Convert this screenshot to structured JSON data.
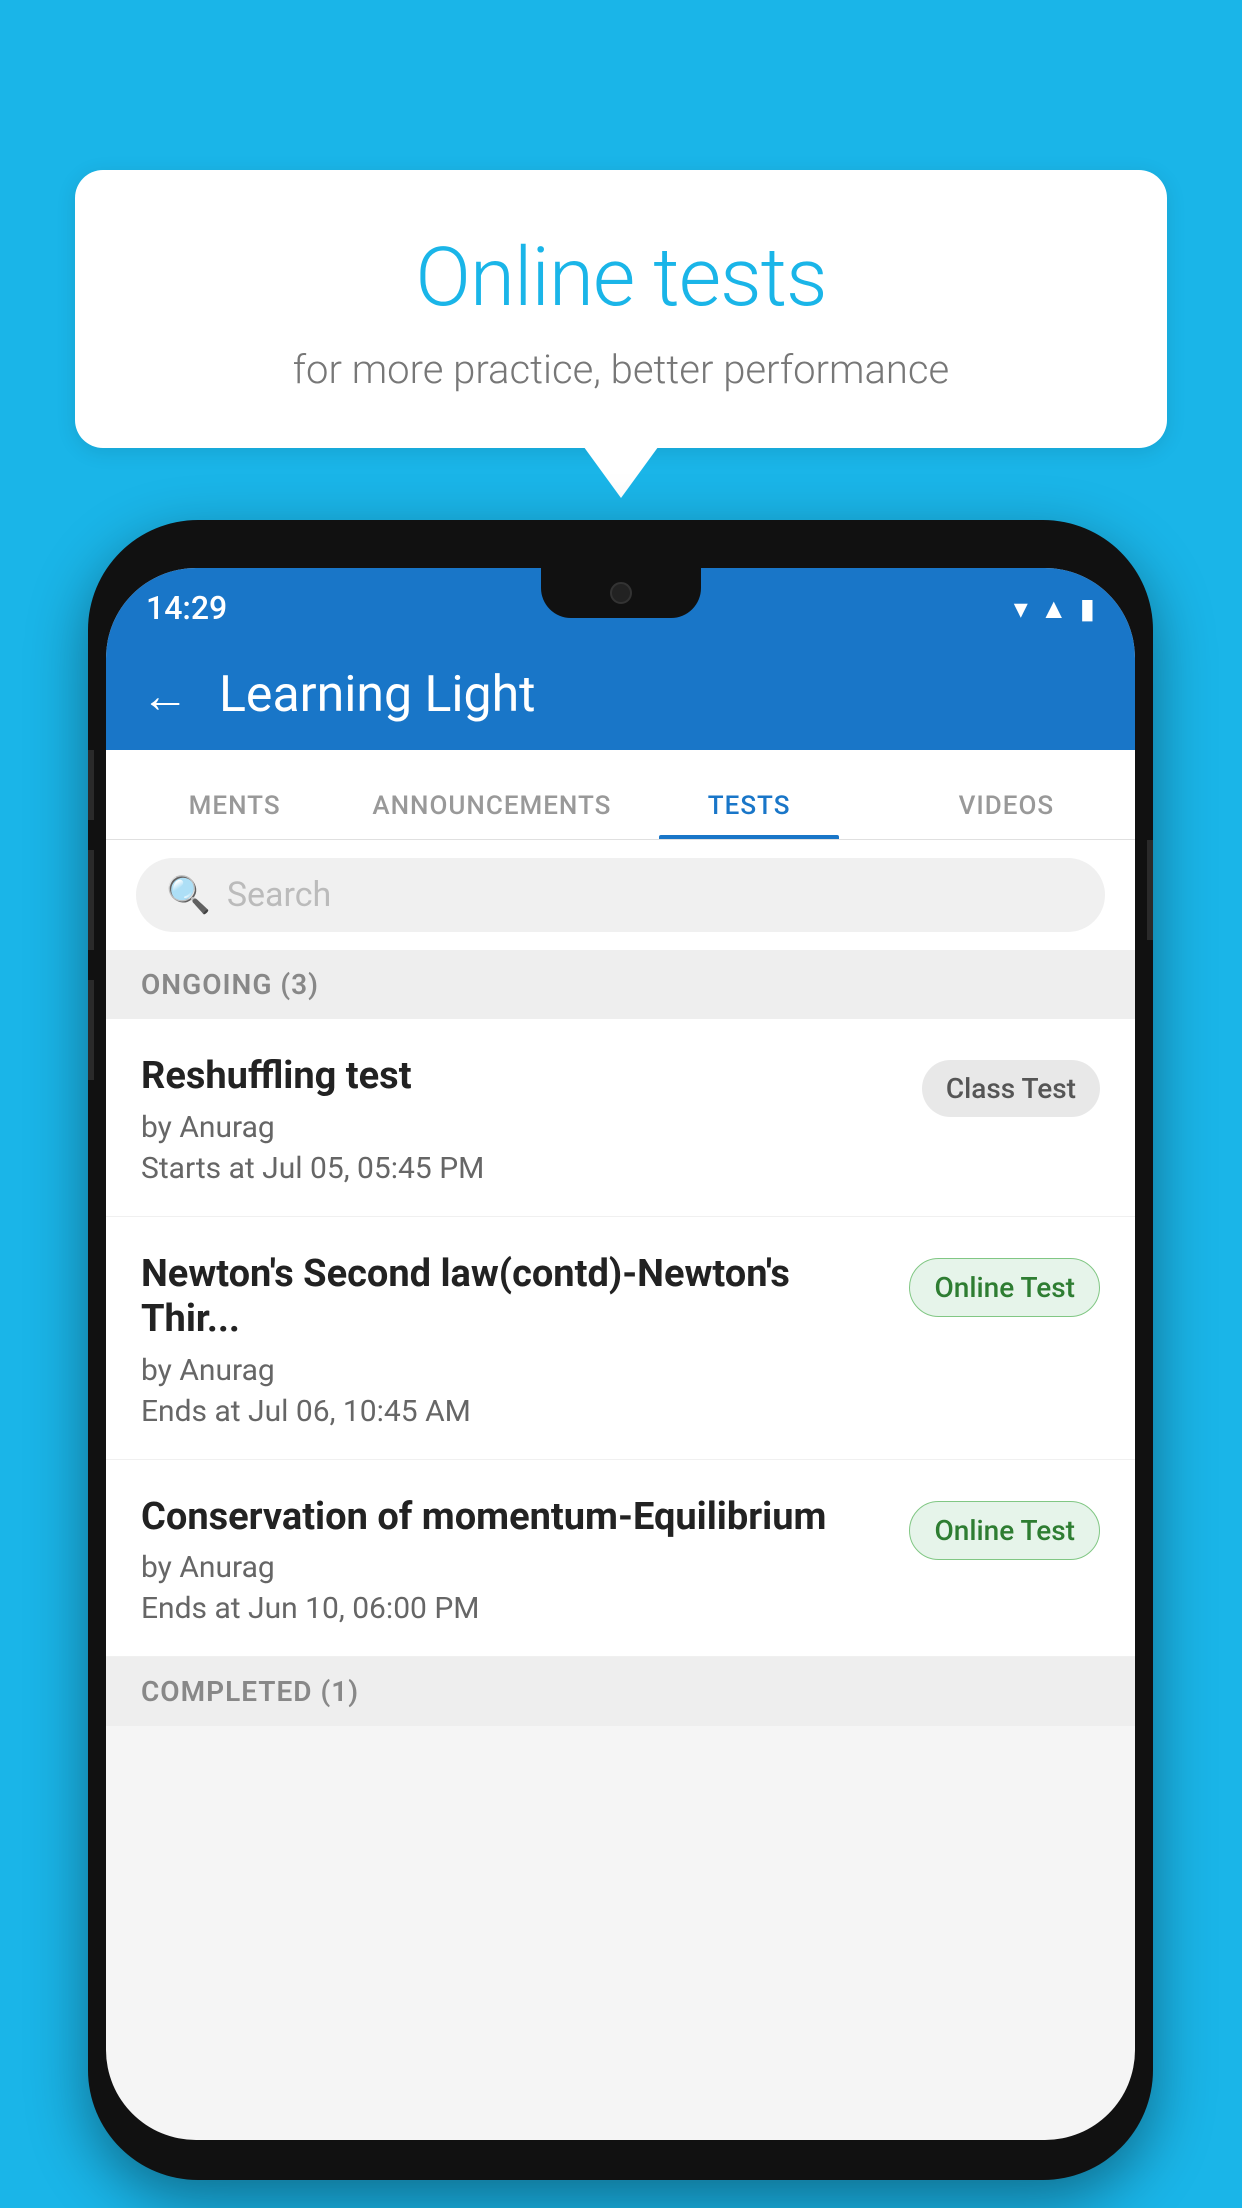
{
  "background_color": "#1ab5e8",
  "speech_bubble": {
    "title": "Online tests",
    "subtitle": "for more practice, better performance"
  },
  "phone": {
    "status_bar": {
      "time": "14:29",
      "icons": [
        "wifi",
        "signal",
        "battery"
      ]
    },
    "header": {
      "title": "Learning Light",
      "back_label": "←"
    },
    "tabs": [
      {
        "label": "MENTS",
        "active": false
      },
      {
        "label": "ANNOUNCEMENTS",
        "active": false
      },
      {
        "label": "TESTS",
        "active": true
      },
      {
        "label": "VIDEOS",
        "active": false
      }
    ],
    "search": {
      "placeholder": "Search"
    },
    "ongoing_section": {
      "label": "ONGOING (3)",
      "tests": [
        {
          "name": "Reshuffling test",
          "by": "by Anurag",
          "time": "Starts at  Jul 05, 05:45 PM",
          "badge": "Class Test",
          "badge_type": "class"
        },
        {
          "name": "Newton's Second law(contd)-Newton's Thir...",
          "by": "by Anurag",
          "time": "Ends at  Jul 06, 10:45 AM",
          "badge": "Online Test",
          "badge_type": "online"
        },
        {
          "name": "Conservation of momentum-Equilibrium",
          "by": "by Anurag",
          "time": "Ends at  Jun 10, 06:00 PM",
          "badge": "Online Test",
          "badge_type": "online"
        }
      ]
    },
    "completed_section": {
      "label": "COMPLETED (1)"
    }
  }
}
